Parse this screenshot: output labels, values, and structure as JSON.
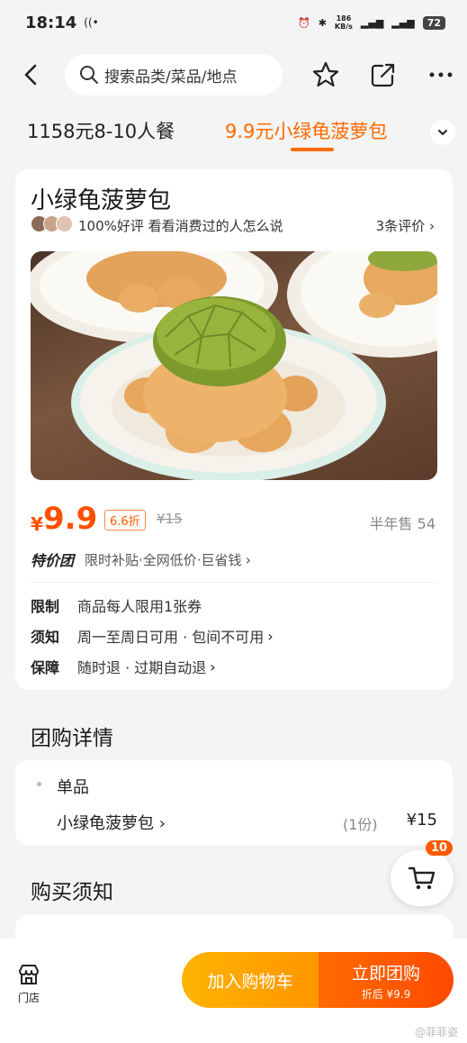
{
  "status_bar": {
    "time": "18:14",
    "net_speed_value": "186",
    "net_speed_unit": "KB/s",
    "battery": "72"
  },
  "header": {
    "search_placeholder": "搜索品类/菜品/地点"
  },
  "tabs": [
    {
      "label": "1158元8-10人餐",
      "active": false
    },
    {
      "label": "9.9元小绿龟菠萝包",
      "active": true
    }
  ],
  "product": {
    "title": "小绿龟菠萝包",
    "rating_text": "100%好评 看看消费过的人怎么说",
    "review_link": "3条评价",
    "price_symbol": "¥",
    "price": "9.9",
    "discount": "6.6折",
    "original_price": "¥15",
    "sold": "半年售 54",
    "promo_logo": "特价团",
    "promo_text": "限时补贴·全网低价·巨省钱",
    "info": [
      {
        "label": "限制",
        "value": "商品每人限用1张券"
      },
      {
        "label": "须知",
        "value": "周一至周日可用 · 包间不可用"
      },
      {
        "label": "保障",
        "value": "随时退 · 过期自动退"
      }
    ]
  },
  "group_detail": {
    "section_title": "团购详情",
    "item_title": "单品",
    "item_name": "小绿龟菠萝包",
    "item_qty": "(1份)",
    "item_price": "¥15"
  },
  "purchase_notice": {
    "section_title": "购买须知"
  },
  "floating_cart": {
    "badge": "10"
  },
  "bottom_bar": {
    "store_label": "门店",
    "add_cart_label": "加入购物车",
    "buy_label": "立即团购",
    "buy_sub_label": "折后 ¥9.9"
  },
  "watermark": "@菲菲姿",
  "colors": {
    "accent": "#ff6a00",
    "price": "#ff5000",
    "cart_button": "#ffa800"
  },
  "icons": [
    "back-arrow-icon",
    "search-icon",
    "star-icon",
    "share-icon",
    "more-icon",
    "chevron-down-icon",
    "cart-icon",
    "store-icon"
  ]
}
